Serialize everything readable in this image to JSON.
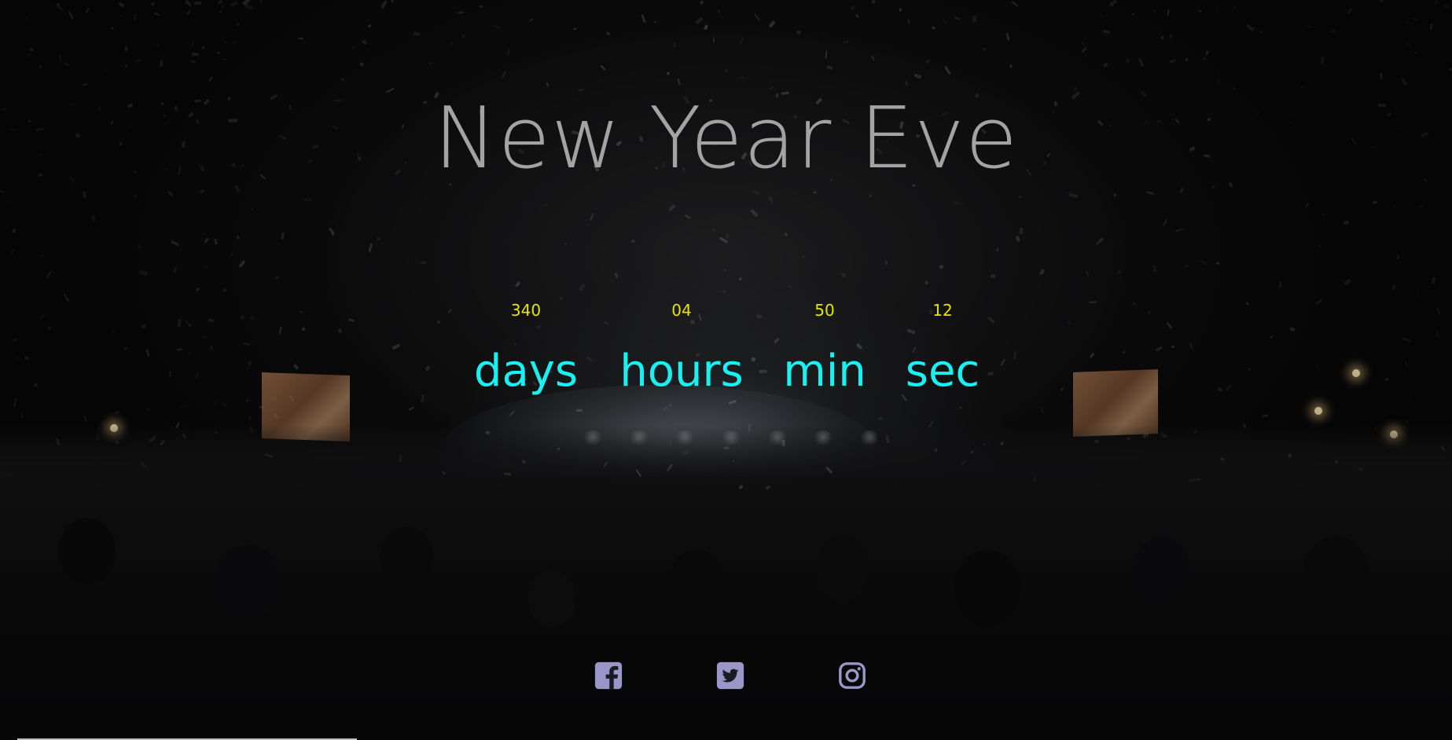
{
  "page": {
    "title": "New Year Eve"
  },
  "countdown": [
    {
      "value": "340",
      "label": "days"
    },
    {
      "value": "04",
      "label": "hours"
    },
    {
      "value": "50",
      "label": "min"
    },
    {
      "value": "12",
      "label": "sec"
    }
  ],
  "social": [
    {
      "name": "facebook-icon"
    },
    {
      "name": "twitter-icon"
    },
    {
      "name": "instagram-icon"
    }
  ],
  "colors": {
    "title": "#a3a3a3",
    "countdown_number": "#e6e600",
    "countdown_label": "#19f0f0",
    "social_icon": "#9a96c8"
  }
}
